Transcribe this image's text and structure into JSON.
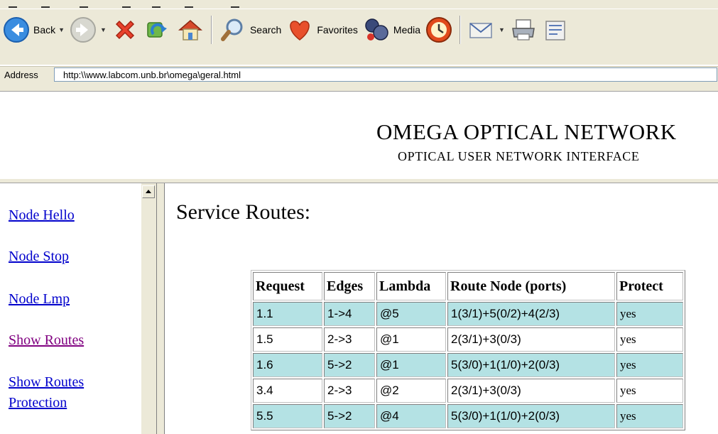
{
  "toolbar": {
    "back_label": "Back",
    "search_label": "Search",
    "favorites_label": "Favorites",
    "media_label": "Media"
  },
  "address_bar": {
    "label": "Address",
    "url": "http:\\\\www.labcom.unb.br\\omega\\geral.html"
  },
  "banner": {
    "title": "OMEGA OPTICAL NETWORK",
    "subtitle": "OPTICAL USER NETWORK INTERFACE"
  },
  "nav": {
    "links": [
      {
        "label": "Node Hello",
        "visited": false
      },
      {
        "label": "Node Stop",
        "visited": false
      },
      {
        "label": "Node Lmp",
        "visited": false
      },
      {
        "label": "Show Routes",
        "visited": true
      },
      {
        "label": "Show Routes",
        "visited": false
      },
      {
        "label": "Protection",
        "visited": false
      }
    ]
  },
  "main": {
    "title": "Service Routes:",
    "table": {
      "columns": [
        "Request",
        "Edges",
        "Lambda",
        "Route Node (ports)",
        "Protect"
      ],
      "rows": [
        [
          "1.1",
          "1->4",
          "@5",
          "1(3/1)+5(0/2)+4(2/3)",
          "yes"
        ],
        [
          "1.5",
          "2->3",
          "@1",
          "2(3/1)+3(0/3)",
          "yes"
        ],
        [
          "1.6",
          "5->2",
          "@1",
          "5(3/0)+1(1/0)+2(0/3)",
          "yes"
        ],
        [
          "3.4",
          "2->3",
          "@2",
          "2(3/1)+3(0/3)",
          "yes"
        ],
        [
          "5.5",
          "5->2",
          "@4",
          "5(3/0)+1(1/0)+2(0/3)",
          "yes"
        ]
      ]
    }
  },
  "colors": {
    "row_highlight": "#b4e2e4",
    "link": "#0000cc",
    "visited_link": "#800080",
    "chrome": "#ece9d8"
  }
}
